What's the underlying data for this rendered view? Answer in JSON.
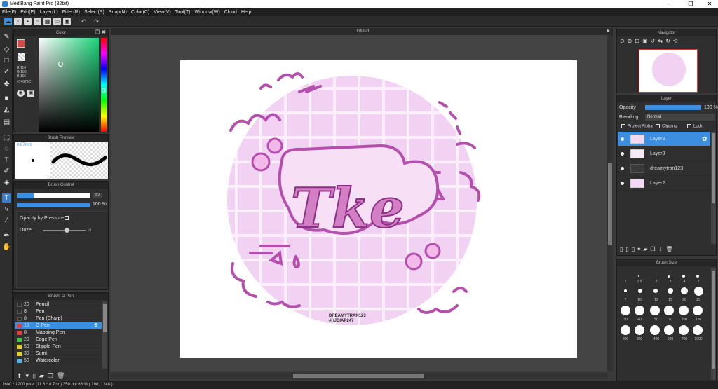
{
  "app": {
    "title": "MediBang Paint Pro (32bit)",
    "minimize": "–",
    "restore": "❐",
    "close": "✕"
  },
  "menu": [
    "File(F)",
    "Edit(E)",
    "Layer(L)",
    "Filter(R)",
    "Select(S)",
    "Snap(N)",
    "Color(C)",
    "View(V)",
    "Tool(T)",
    "Window(W)",
    "Cloud",
    "Help"
  ],
  "color_panel": {
    "title": "Color",
    "r": "R:116",
    "g": "G:183",
    "b": "B:156",
    "hex": "#74879C",
    "accent": "#74879C"
  },
  "brush_preview": {
    "title": "Brush Preview",
    "size": "0.87mm"
  },
  "brush_control": {
    "title": "Brush Control",
    "size_value": "12",
    "opacity_value": "100 %",
    "opacity_pressure_label": "Opacity by Pressure",
    "ooze_label": "Ooze",
    "ooze_value": "3"
  },
  "brush_list": {
    "title": "Brush: G Pen",
    "items": [
      {
        "size": "20",
        "name": "Pencil",
        "color": "#2b2b2b"
      },
      {
        "size": "8",
        "name": "Pen",
        "color": "#2b2b2b"
      },
      {
        "size": "8",
        "name": "Pen (Sharp)",
        "color": "#2b2b2b"
      },
      {
        "size": "13",
        "name": "G Pen",
        "color": "#e23c3c",
        "selected": true
      },
      {
        "size": "8",
        "name": "Mapping Pen",
        "color": "#e23c3c"
      },
      {
        "size": "20",
        "name": "Edge Pen",
        "color": "#38c838"
      },
      {
        "size": "50",
        "name": "Stipple Pen",
        "color": "#e8d020"
      },
      {
        "size": "30",
        "name": "Sumi",
        "color": "#e8d020"
      },
      {
        "size": "50",
        "name": "Watercolor",
        "color": "#5ab4e8"
      }
    ]
  },
  "canvas": {
    "tab_title": "Untitled"
  },
  "artwork": {
    "main_text": "Tke",
    "signature_line1": "DREAMYTRAN123",
    "signature_line2": "#HJDIAP247"
  },
  "navigator": {
    "title": "Navigator"
  },
  "layer_panel": {
    "title": "Layer",
    "opacity_label": "Opacity",
    "opacity_value": "100 %",
    "blending_label": "Blending",
    "blending_value": "Normal",
    "protect_alpha": "Protect Alpha",
    "clipping": "Clipping",
    "lock": "Lock",
    "layers": [
      {
        "name": "Layer3",
        "selected": true
      },
      {
        "name": "Layer3"
      },
      {
        "name": "dreamytran123"
      },
      {
        "name": "Layer2"
      }
    ]
  },
  "brush_size": {
    "title": "Brush Size",
    "labels": [
      ".",
      ".",
      "1",
      "1.5",
      "2",
      "3",
      "4",
      "5",
      "7",
      "10",
      "12",
      "15",
      "20",
      "25",
      "30",
      "40",
      "50",
      "70",
      "100",
      "150",
      "200",
      "300",
      "400",
      "500",
      "700",
      "1000"
    ]
  },
  "status": {
    "text": "1600 * 1200 pixel   (11.6 * 8.7cm)   350 dpi   66 %   ( 198, 1248 )"
  }
}
